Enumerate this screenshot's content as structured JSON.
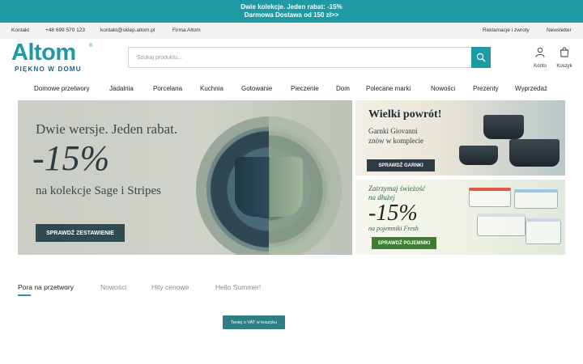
{
  "promo": {
    "line1": "Dwie kolekcje. Jeden rabat: -15%",
    "line2": "Darmowa Dostawa od 150 zł>>"
  },
  "utility": {
    "contact": "Kontakt",
    "phone": "+48 699 570 123",
    "email": "kontakt@sklep.altom.pl",
    "company": "Firma Altom",
    "returns": "Reklamacje i zwroty",
    "newsletter": "Newsletter"
  },
  "logo": {
    "name": "Altom",
    "tagline": "PIĘKNO W DOMU"
  },
  "search": {
    "placeholder": "Szukaj produktu..."
  },
  "header_actions": {
    "account": "Konto",
    "cart": "Koszyk"
  },
  "nav": {
    "items": [
      "Domowe przetwory",
      "Jadalnia",
      "Porcelana",
      "Kuchnia",
      "Gotowanie",
      "Pieczenie",
      "Dom",
      "Polecane marki",
      "Nowości",
      "Prezenty",
      "Wyprzedaż"
    ]
  },
  "hero": {
    "headline": "Dwie wersje. Jeden rabat.",
    "discount": "-15%",
    "subline": "na kolekcje Sage i Stripes",
    "cta": "SPRAWDŹ ZESTAWIENIE"
  },
  "side_banner_1": {
    "headline": "Wielki powrót!",
    "text_line1": "Garnki Giovanni",
    "text_line2": "znów w komplecie",
    "cta": "SPRAWDŹ GARNKI"
  },
  "side_banner_2": {
    "text_line1": "Zatrzymaj świeżość",
    "text_line2": "na dłużej",
    "discount": "-15%",
    "subline": "na pojemniki Fresh",
    "cta": "SPRAWDŹ POJEMNIKI"
  },
  "tabs": {
    "items": [
      "Pora na przetwory",
      "Nowości",
      "Hity cenowe",
      "Hello Summer!"
    ],
    "active": "Pora na przetwory"
  },
  "vat_button": "Taniej o VAT w koszyku",
  "colors": {
    "brand": "#1e9aa5",
    "nav_text": "#222222",
    "hero_cta": "#2f4a50",
    "fresh_cta": "#3f7d35"
  }
}
